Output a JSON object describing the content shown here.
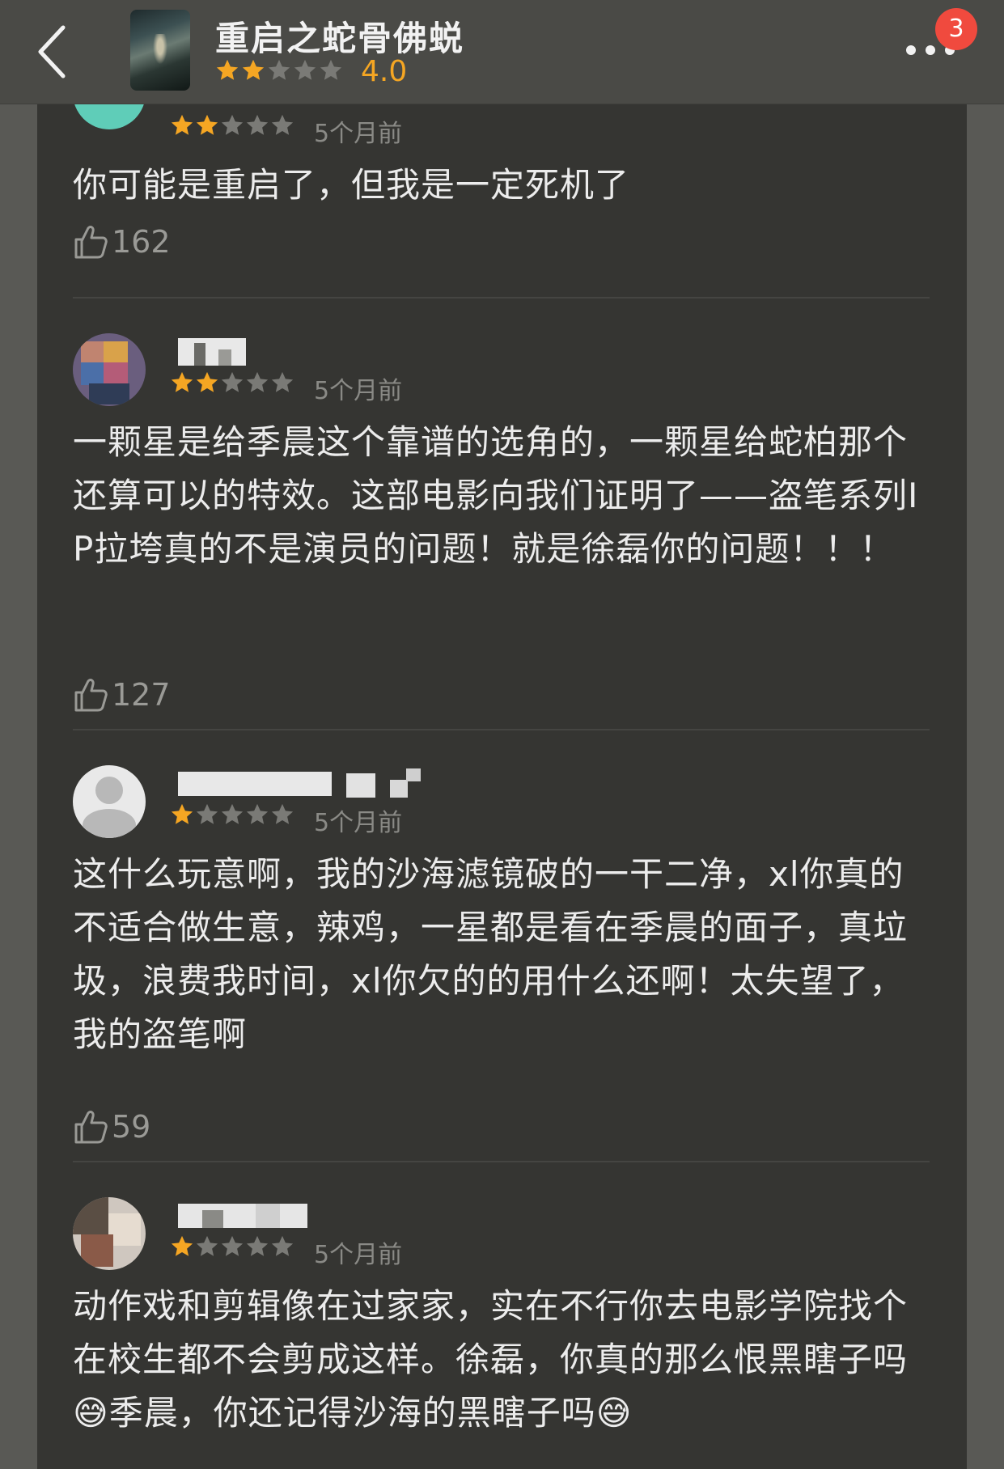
{
  "header": {
    "back_icon": "chevron-left-icon",
    "title": "重启之蛇骨佛蜕",
    "stars_filled": 2,
    "rating": "4.0",
    "more_icon": "more-dots-icon",
    "badge_count": "3"
  },
  "reviews": [
    {
      "stars_filled": 2,
      "time": "5个月前",
      "text": "你可能是重启了，但我是一定死机了",
      "likes": "162"
    },
    {
      "stars_filled": 2,
      "time": "5个月前",
      "text": "一颗星是给季晨这个靠谱的选角的，一颗星给蛇柏那个还算可以的特效。这部电影向我们证明了——盗笔系列IP拉垮真的不是演员的问题！就是徐磊你的问题！！！",
      "likes": "127"
    },
    {
      "stars_filled": 1,
      "time": "5个月前",
      "text": "这什么玩意啊，我的沙海滤镜破的一干二净，xl你真的不适合做生意，辣鸡，一星都是看在季晨的面子，真垃圾，浪费我时间，xl你欠的的用什么还啊！太失望了，我的盗笔啊",
      "likes": "59"
    },
    {
      "stars_filled": 1,
      "time": "5个月前",
      "text": "动作戏和剪辑像在过家家，实在不行你去电影学院找个在校生都不会剪成这样。徐磊，你真的那么恨黑瞎子吗😅季晨，你还记得沙海的黑瞎子吗😅",
      "likes": ""
    }
  ],
  "colors": {
    "star": "#f5a623",
    "star_empty": "#7a7a76",
    "badge": "#f04a3e"
  }
}
